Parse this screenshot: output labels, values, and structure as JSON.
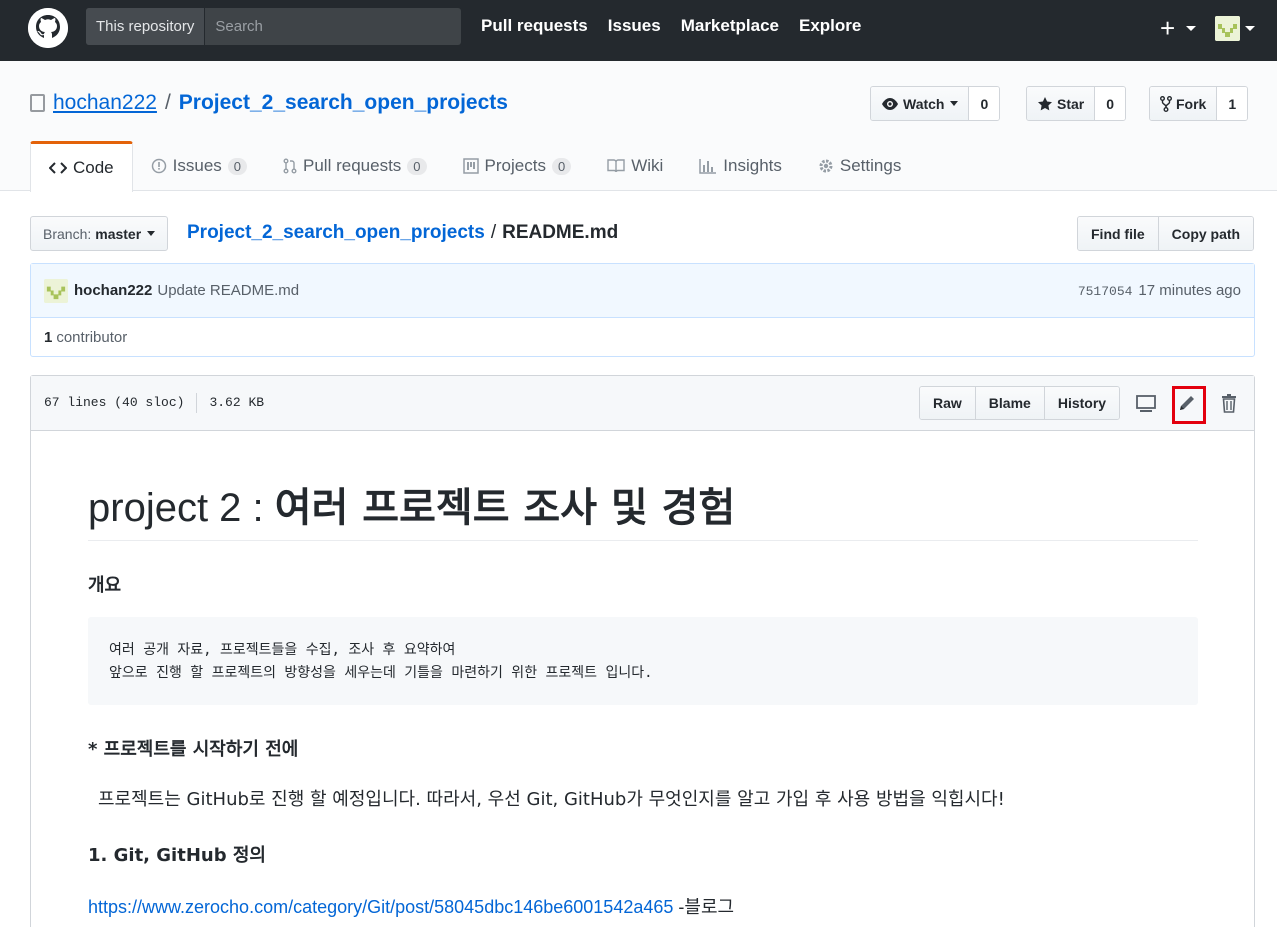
{
  "header": {
    "scope_label": "This repository",
    "search_placeholder": "Search",
    "nav": [
      "Pull requests",
      "Issues",
      "Marketplace",
      "Explore"
    ],
    "plus_label": "+"
  },
  "repo": {
    "owner": "hochan222",
    "separator": "/",
    "name": "Project_2_search_open_projects",
    "watch_label": "Watch",
    "watch_count": "0",
    "star_label": "Star",
    "star_count": "0",
    "fork_label": "Fork",
    "fork_count": "1"
  },
  "tabs": [
    {
      "label": "Code",
      "count": null,
      "icon": "code-icon"
    },
    {
      "label": "Issues",
      "count": "0",
      "icon": "issue-icon"
    },
    {
      "label": "Pull requests",
      "count": "0",
      "icon": "pull-request-icon"
    },
    {
      "label": "Projects",
      "count": "0",
      "icon": "project-icon"
    },
    {
      "label": "Wiki",
      "count": null,
      "icon": "book-icon"
    },
    {
      "label": "Insights",
      "count": null,
      "icon": "graph-icon"
    },
    {
      "label": "Settings",
      "count": null,
      "icon": "gear-icon"
    }
  ],
  "branch": {
    "label": "Branch:",
    "value": "master"
  },
  "breadcrumb": {
    "repo_link": "Project_2_search_open_projects",
    "separator": "/",
    "file": "README.md"
  },
  "file_actions": {
    "find_file": "Find file",
    "copy_path": "Copy path"
  },
  "commit": {
    "author": "hochan222",
    "message": "Update README.md",
    "sha": "7517054",
    "time": "17 minutes ago",
    "contributor_count": "1",
    "contributor_label": "contributor"
  },
  "file": {
    "lines": "67 lines (40 sloc)",
    "size": "3.62 KB",
    "raw": "Raw",
    "blame": "Blame",
    "history": "History"
  },
  "readme": {
    "title_latin": "project 2 : ",
    "title_korean": "여러 프로젝트 조사 및 경험",
    "overview_heading": "개요",
    "overview_line1": "여러 공개 자료, 프로젝트들을 수집, 조사 후 요약하여",
    "overview_line2": "앞으로 진행 할 프로젝트의 방향성을 세우는데 기틀을 마련하기 위한 프로젝트 입니다.",
    "before_heading": "* 프로젝트를 시작하기 전에",
    "before_text": "프로젝트는 GitHub로 진행 할 예정입니다. 따라서, 우선 Git, GitHub가 무엇인지를 알고 가입 후 사용 방법을 익힙시다!",
    "git_heading": "1. Git, GitHub 정의",
    "link_url": "https://www.zerocho.com/category/Git/post/58045dbc146be6001542a465",
    "link_suffix": " -블로그"
  }
}
